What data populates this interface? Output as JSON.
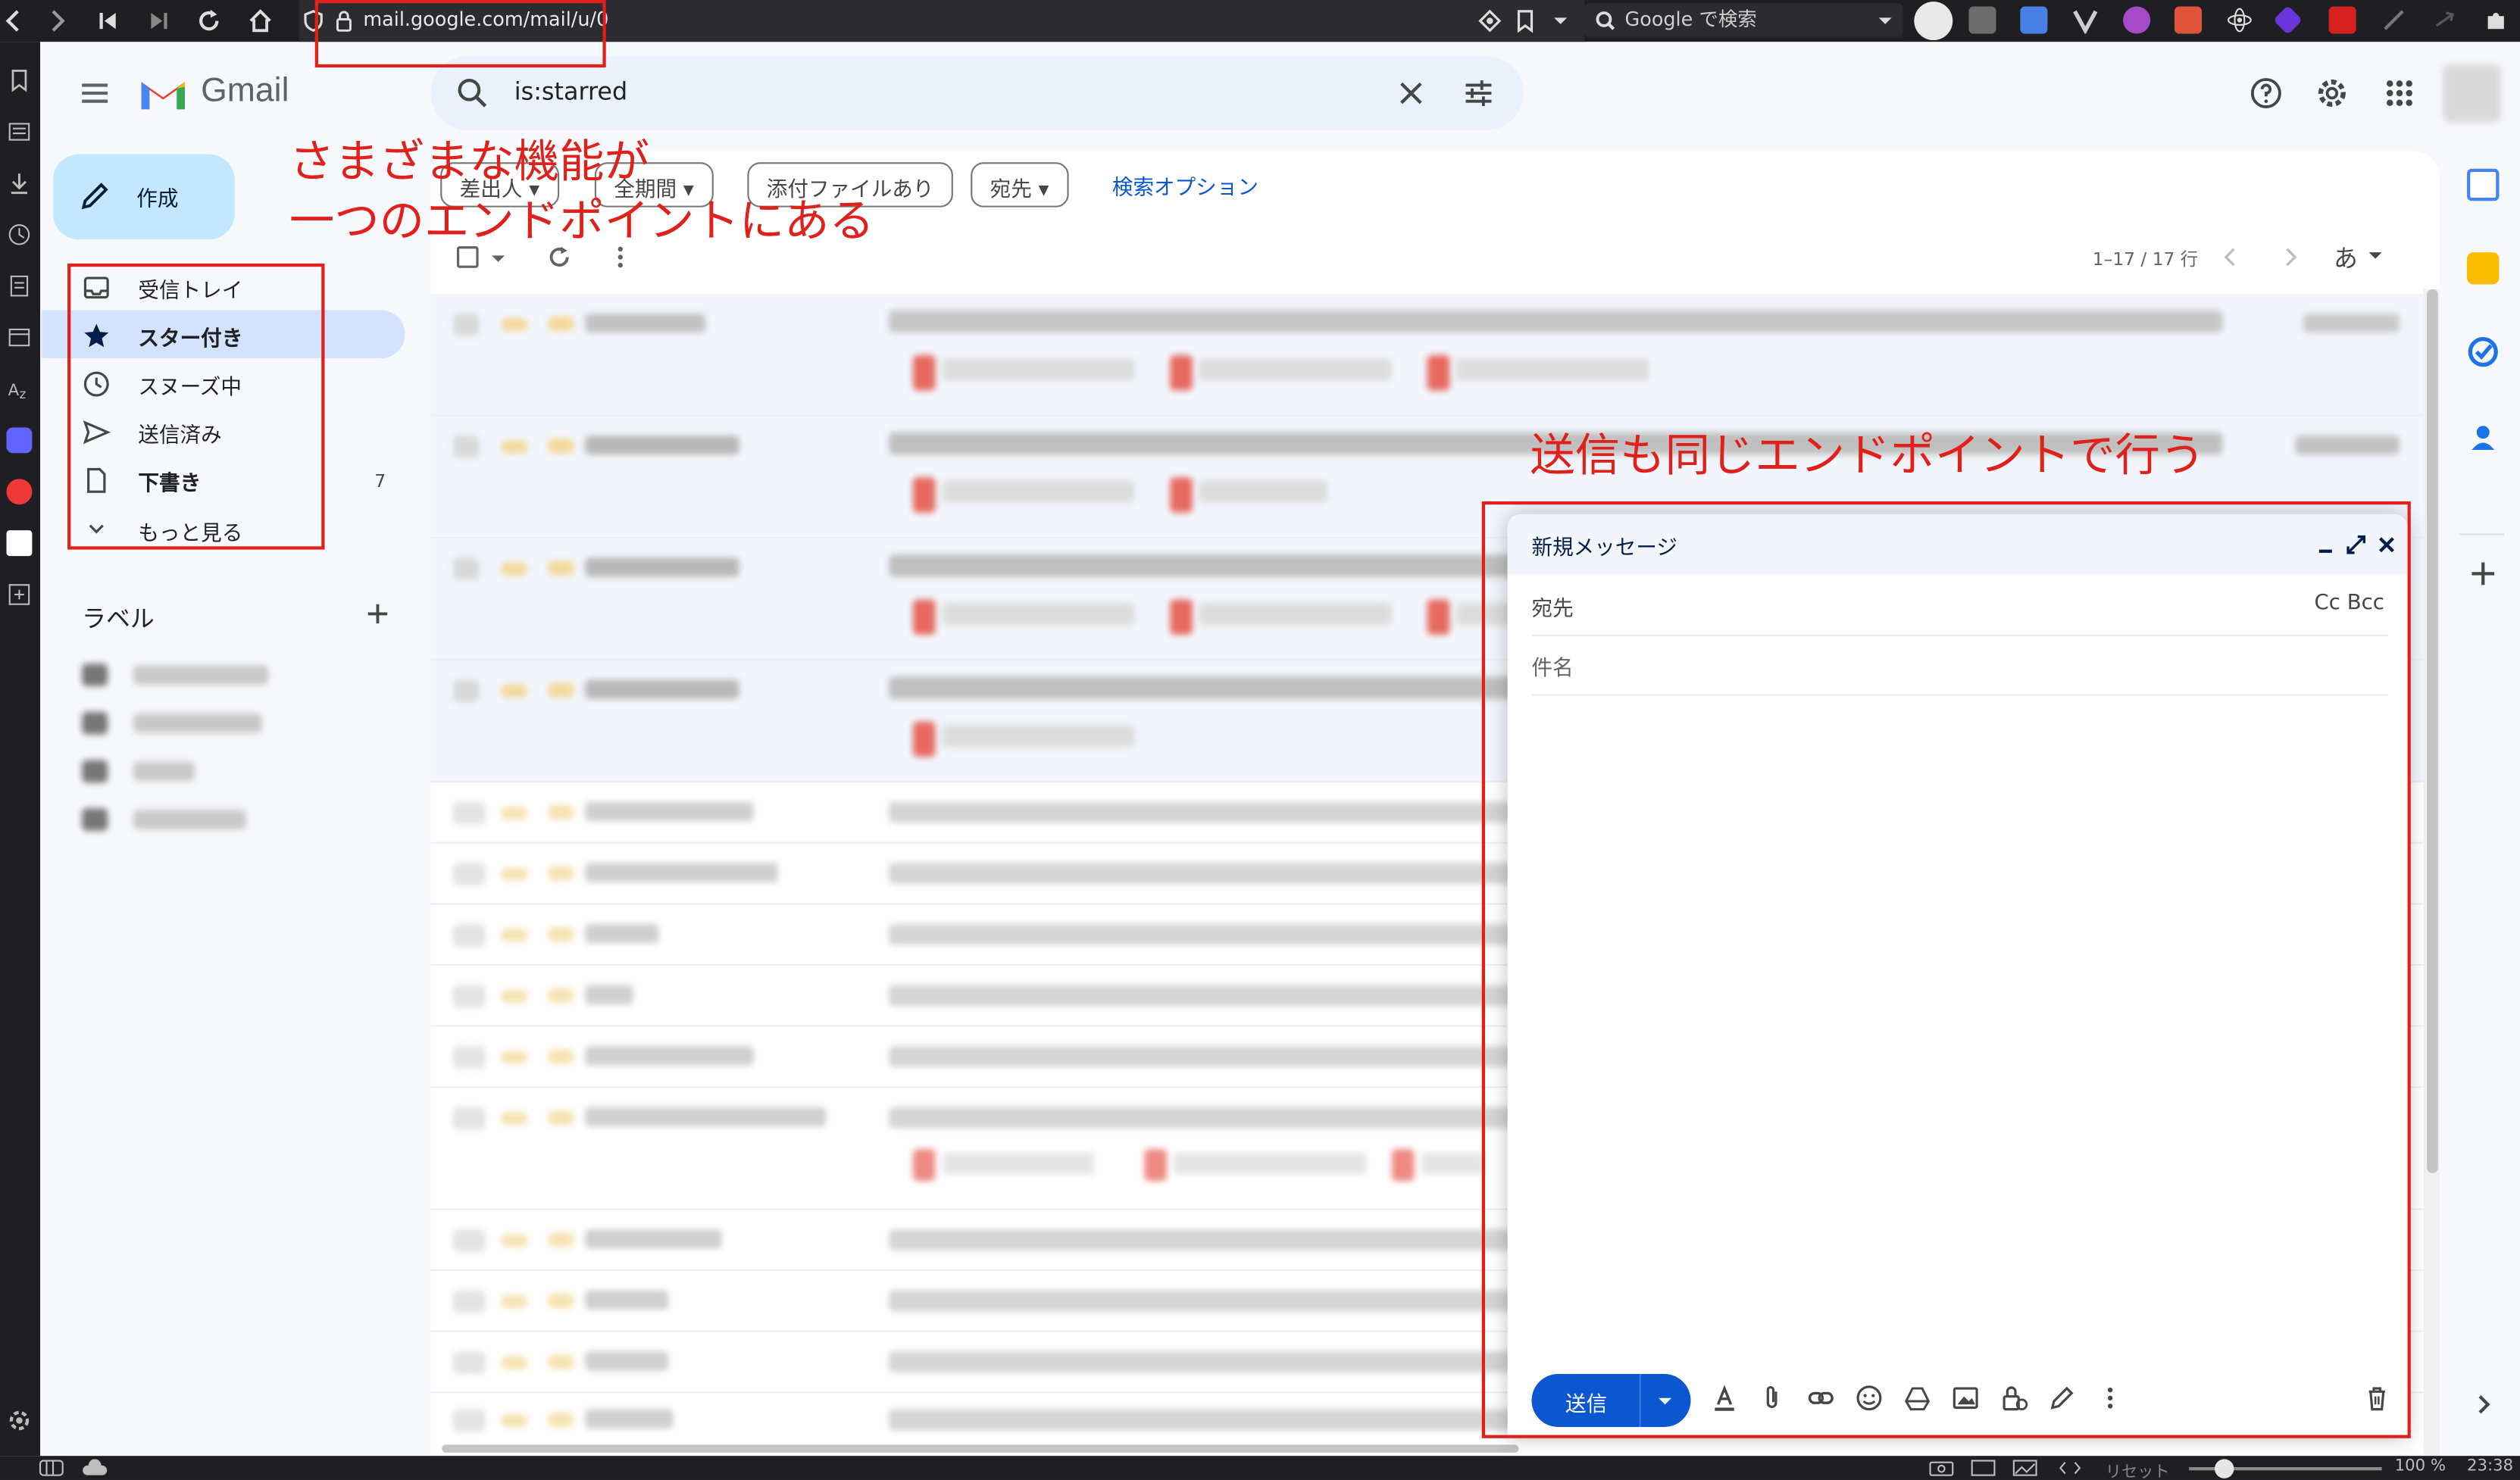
{
  "browser": {
    "url": "mail.google.com/mail/u/0",
    "search_placeholder": "Google で検索",
    "status_reset": "リセット",
    "zoom": "100 %",
    "clock": "23:38"
  },
  "app": {
    "name": "Gmail"
  },
  "search": {
    "query": "is:starred"
  },
  "compose_button": {
    "label": "作成"
  },
  "nav": {
    "items": [
      {
        "label": "受信トレイ",
        "count": "",
        "icon": "inbox-icon"
      },
      {
        "label": "スター付き",
        "count": "",
        "icon": "star-icon",
        "active": true
      },
      {
        "label": "スヌーズ中",
        "count": "",
        "icon": "clock-icon"
      },
      {
        "label": "送信済み",
        "count": "",
        "icon": "send-icon"
      },
      {
        "label": "下書き",
        "count": "7",
        "icon": "draft-icon"
      },
      {
        "label": "もっと見る",
        "count": "",
        "icon": "chevron-down-icon"
      }
    ]
  },
  "labels": {
    "title": "ラベル"
  },
  "filters": {
    "chips": [
      "差出人",
      "全期間",
      "添付ファイルあり",
      "宛先"
    ],
    "advanced": "検索オプション"
  },
  "toolbar": {
    "pager": "1–17 / 17 行",
    "input_tool": "あ"
  },
  "compose_window": {
    "title": "新規メッセージ",
    "to_label": "宛先",
    "cc_bcc": "Cc Bcc",
    "subject_placeholder": "件名",
    "send_label": "送信"
  },
  "annotations": {
    "top_line1": "さまざまな機能が",
    "top_line2": "一つのエンドポイントにある",
    "compose_note": "送信も同じエンドポイントで行う"
  },
  "colors": {
    "annotation_red": "#e0201a",
    "accent_blue": "#0b57d0",
    "active_nav": "#d3e3fd",
    "compose_button": "#c2e7ff"
  }
}
